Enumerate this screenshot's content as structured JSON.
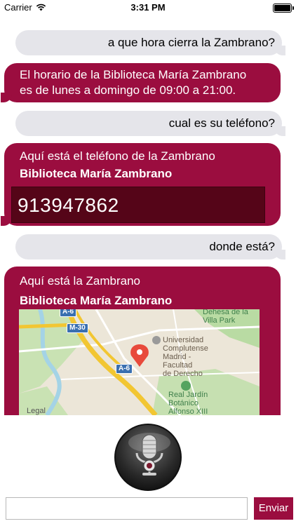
{
  "status_bar": {
    "carrier": "Carrier",
    "time": "3:31 PM",
    "battery_level": 1.0
  },
  "conversation": {
    "msg1": {
      "text": "a que hora cierra la Zambrano?"
    },
    "msg2": {
      "line1": "El horario de la Biblioteca María Zambrano",
      "line2": "es de lunes a domingo de 09:00 a 21:00."
    },
    "msg3": {
      "text": "cual es su teléfono?"
    },
    "msg4": {
      "intro": "Aquí está el teléfono de la Zambrano",
      "name": "Biblioteca María Zambrano",
      "phone": "913947862"
    },
    "msg5": {
      "text": "donde está?"
    },
    "msg6": {
      "intro": "Aquí está la Zambrano",
      "name": "Biblioteca María Zambrano"
    }
  },
  "map": {
    "label_park_line1": "Dehesa de la",
    "label_park_line2": "Villa Park",
    "label_univ_line1": "Universidad",
    "label_univ_line2": "Complutense",
    "label_univ_line3": "Madrid -",
    "label_univ_line4": "Facultad",
    "label_univ_line5": "de Derecho",
    "label_garden_line1": "Real Jardín",
    "label_garden_line2": "Botánico",
    "label_garden_line3": "Alfonso XIII",
    "legal": "Legal",
    "road_a6_top": "A-6",
    "road_m30": "M-30",
    "road_a6_mid": "A-6",
    "colors": {
      "pin": "#e84a3c",
      "highway": "#f2c632",
      "water": "#a4d3e6",
      "park": "#b9dba3"
    }
  },
  "composer": {
    "input_value": "",
    "input_placeholder": "",
    "send_label": "Enviar"
  },
  "theme": {
    "bot_bubble": "#9b0d3f",
    "user_bubble": "#e5e5ea"
  },
  "icons": [
    "wifi-icon",
    "battery-icon",
    "map-pin-icon",
    "microphone-icon"
  ]
}
